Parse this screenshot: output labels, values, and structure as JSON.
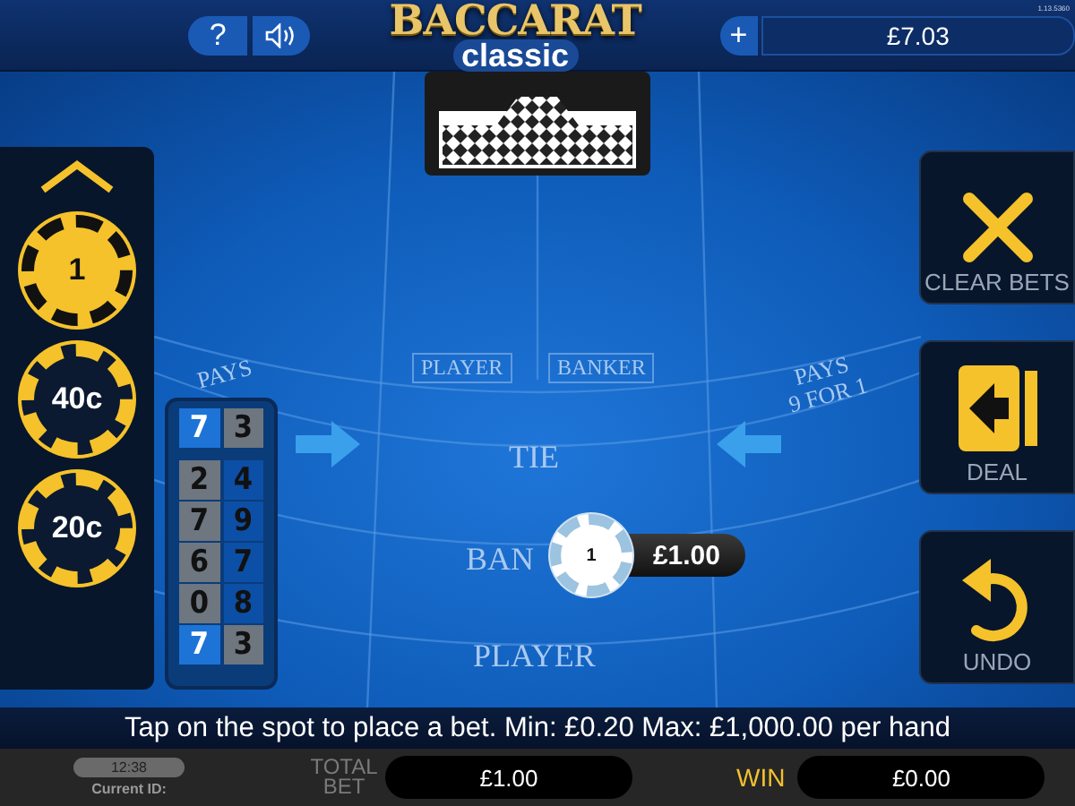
{
  "top_bar": {
    "help_button": "?",
    "add_funds_button": "+",
    "balance": "£7.03",
    "version": "1.13.5360"
  },
  "logo": {
    "title": "BACCARAT",
    "subtitle": "classic"
  },
  "chips": [
    {
      "label": "1",
      "selected": true
    },
    {
      "label": "40c",
      "selected": false
    },
    {
      "label": "20c",
      "selected": false
    }
  ],
  "actions": [
    {
      "kind": "clear",
      "label": "CLEAR BETS"
    },
    {
      "kind": "deal",
      "label": "DEAL"
    },
    {
      "kind": "undo",
      "label": "UNDO"
    }
  ],
  "scoreboard": {
    "latest": {
      "player": "7",
      "banker": "3",
      "player_won": true
    },
    "rows": [
      {
        "player": "2",
        "banker": "4",
        "player_won": false
      },
      {
        "player": "7",
        "banker": "9",
        "player_won": false
      },
      {
        "player": "6",
        "banker": "7",
        "player_won": false
      },
      {
        "player": "0",
        "banker": "8",
        "player_won": false
      },
      {
        "player": "7",
        "banker": "3",
        "player_won": true
      }
    ]
  },
  "table": {
    "side_labels": [
      "PLAYER",
      "BANKER"
    ],
    "left_pays": "PAYS",
    "right_pays": "PAYS\n9 FOR 1",
    "tie": "TIE",
    "banker": "BAN",
    "player": "PLAYER"
  },
  "bet": {
    "chip": "1",
    "amount": "£1.00"
  },
  "message": "Tap on the spot to place a bet. Min: £0.20 Max: £1,000.00 per hand",
  "bottom_bar": {
    "clock": "12:38",
    "current_id": "Current ID:",
    "total_bet_label": "TOTAL BET",
    "total_bet": "£1.00",
    "win_label": "WIN",
    "win": "£0.00"
  }
}
